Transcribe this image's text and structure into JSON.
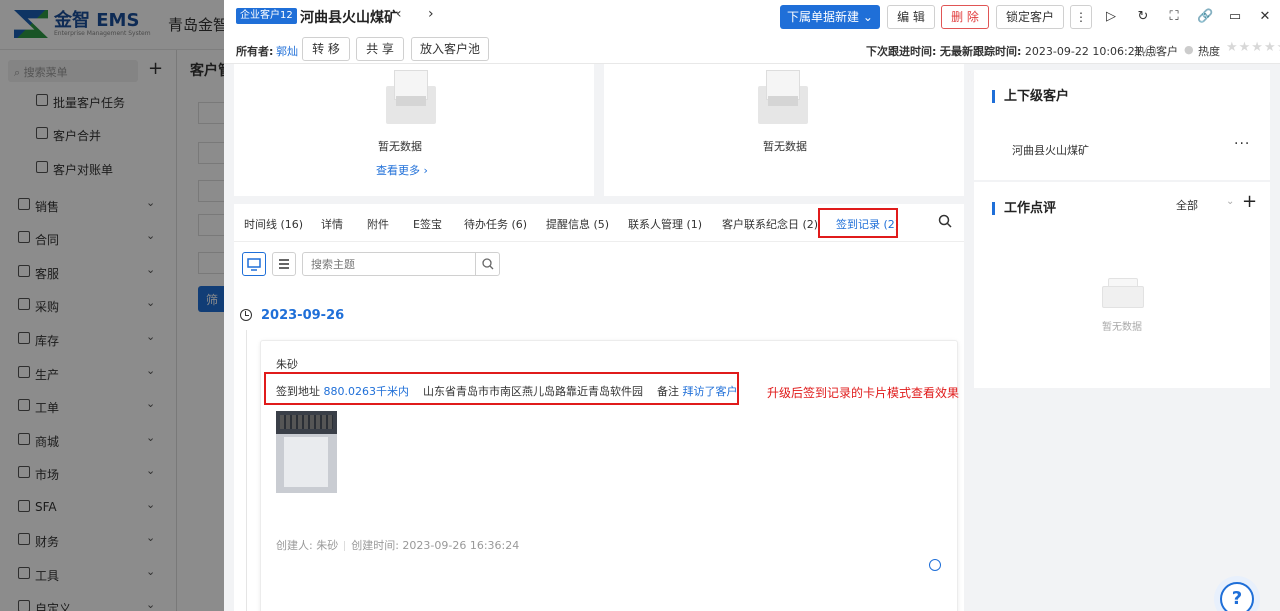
{
  "background": {
    "logo_text": "金智 EMS",
    "logo_sub": "Enterprise Management System",
    "company": "青岛金智",
    "search_placeholder": "搜索菜单",
    "main_title": "客户管",
    "filter_btn": "筛",
    "submenu": [
      "批量客户任务",
      "客户合并",
      "客户对账单"
    ],
    "menu": [
      "销售",
      "合同",
      "客服",
      "采购",
      "库存",
      "生产",
      "工单",
      "商城",
      "市场",
      "SFA",
      "财务",
      "工具",
      "自定义"
    ]
  },
  "header": {
    "tag": "企业客户12",
    "customer_name": "河曲县火山煤矿",
    "prev": "‹",
    "next": "›",
    "new_doc_btn": "下属单据新建",
    "edit_btn": "编 辑",
    "delete_btn": "删 除",
    "lock_btn": "锁定客户",
    "more": "⋮",
    "owner_label": "所有者:",
    "owner_value": "郭灿",
    "transfer_btn": "转 移",
    "share_btn": "共 享",
    "pool_btn": "放入客户池",
    "next_follow_label": "下次跟进时间:",
    "next_follow_value": "无",
    "last_follow_label": "最新跟踪时间:",
    "last_follow_value": "2023-09-22 10:06:21",
    "hot_label": "热点客户",
    "heat_label": "热度",
    "stars": "★★★★★"
  },
  "empty_cards": {
    "left_text": "暂无数据",
    "left_more": "查看更多",
    "right_text": "暂无数据"
  },
  "tabs": [
    {
      "label": "时间线 (16)"
    },
    {
      "label": "详情"
    },
    {
      "label": "附件"
    },
    {
      "label": "E签宝"
    },
    {
      "label": "待办任务 (6)"
    },
    {
      "label": "提醒信息 (5)"
    },
    {
      "label": "联系人管理 (1)"
    },
    {
      "label": "客户联系纪念日 (2)"
    },
    {
      "label": "签到记录 (2)"
    }
  ],
  "list": {
    "search_placeholder": "搜索主题",
    "date": "2023-09-26",
    "record": {
      "user": "朱砂",
      "addr_label": "签到地址",
      "distance": "880.0263千米内",
      "address": "山东省青岛市市南区燕儿岛路靠近青岛软件园",
      "remark_label": "备注",
      "remark_value": "拜访了客户",
      "creator": "创建人: 朱砂",
      "created_time": "创建时间: 2023-09-26 16:36:24"
    }
  },
  "annotation": "升级后签到记录的卡片模式查看效果",
  "right": {
    "parent_title": "上下级客户",
    "parent_item": "河曲县火山煤矿",
    "review_title": "工作点评",
    "review_filter": "全部",
    "review_empty": "暂无数据"
  },
  "help": "?",
  "colors": {
    "primary": "#1f6fd8",
    "danger": "#e01b1b"
  }
}
